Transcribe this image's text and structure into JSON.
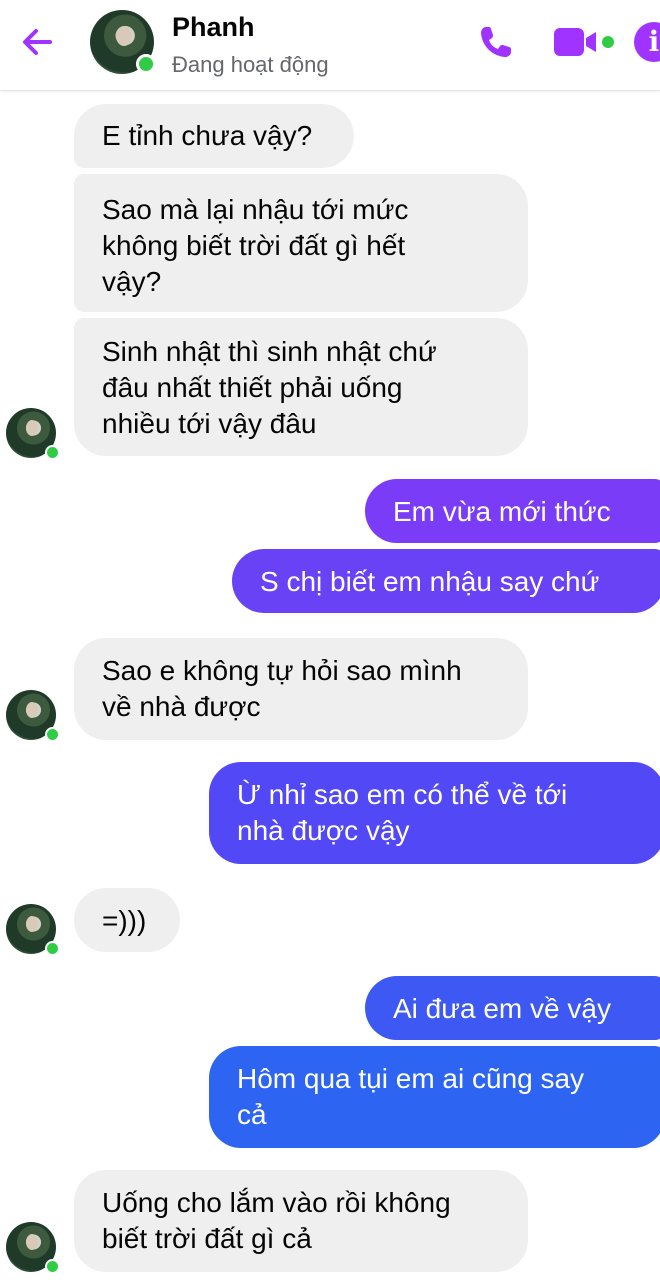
{
  "header": {
    "contact_name": "Phanh",
    "status": "Đang hoạt động",
    "icons": {
      "back": "arrow-left-icon",
      "call": "phone-icon",
      "video": "video-camera-icon",
      "info": "info-icon"
    },
    "accent_color": "#a033ff"
  },
  "messages": [
    {
      "from": "Phanh",
      "text": "E tỉnh chưa vậy?"
    },
    {
      "from": "Phanh",
      "text": "Sao mà lại nhậu tới mức\nkhông biết trời đất gì hết\nvậy?"
    },
    {
      "from": "Phanh",
      "text": "Sinh nhật thì sinh nhật chứ\nđâu nhất thiết phải uống\nnhiều tới vậy đâu"
    },
    {
      "from": "me",
      "text": "Em vừa mới thức"
    },
    {
      "from": "me",
      "text": "S chị biết em nhậu say chứ"
    },
    {
      "from": "Phanh",
      "text": "Sao e không tự hỏi sao mình\nvề nhà được"
    },
    {
      "from": "me",
      "text": "Ừ nhỉ sao em có thể về tới\nnhà được vậy"
    },
    {
      "from": "Phanh",
      "text": "=)))"
    },
    {
      "from": "me",
      "text": "Ai đưa em về vậy"
    },
    {
      "from": "me",
      "text": "Hôm qua tụi em ai cũng say\ncả"
    },
    {
      "from": "Phanh",
      "text": "Uống cho lắm vào rồi không\nbiết trời đất gì cả"
    }
  ],
  "colors": {
    "incoming_bubble": "#efefef",
    "outgoing_purple": "#7a3cf6",
    "outgoing_indigo": "#5248f5",
    "outgoing_blue": "#2d65f2",
    "online": "#31cc46"
  }
}
